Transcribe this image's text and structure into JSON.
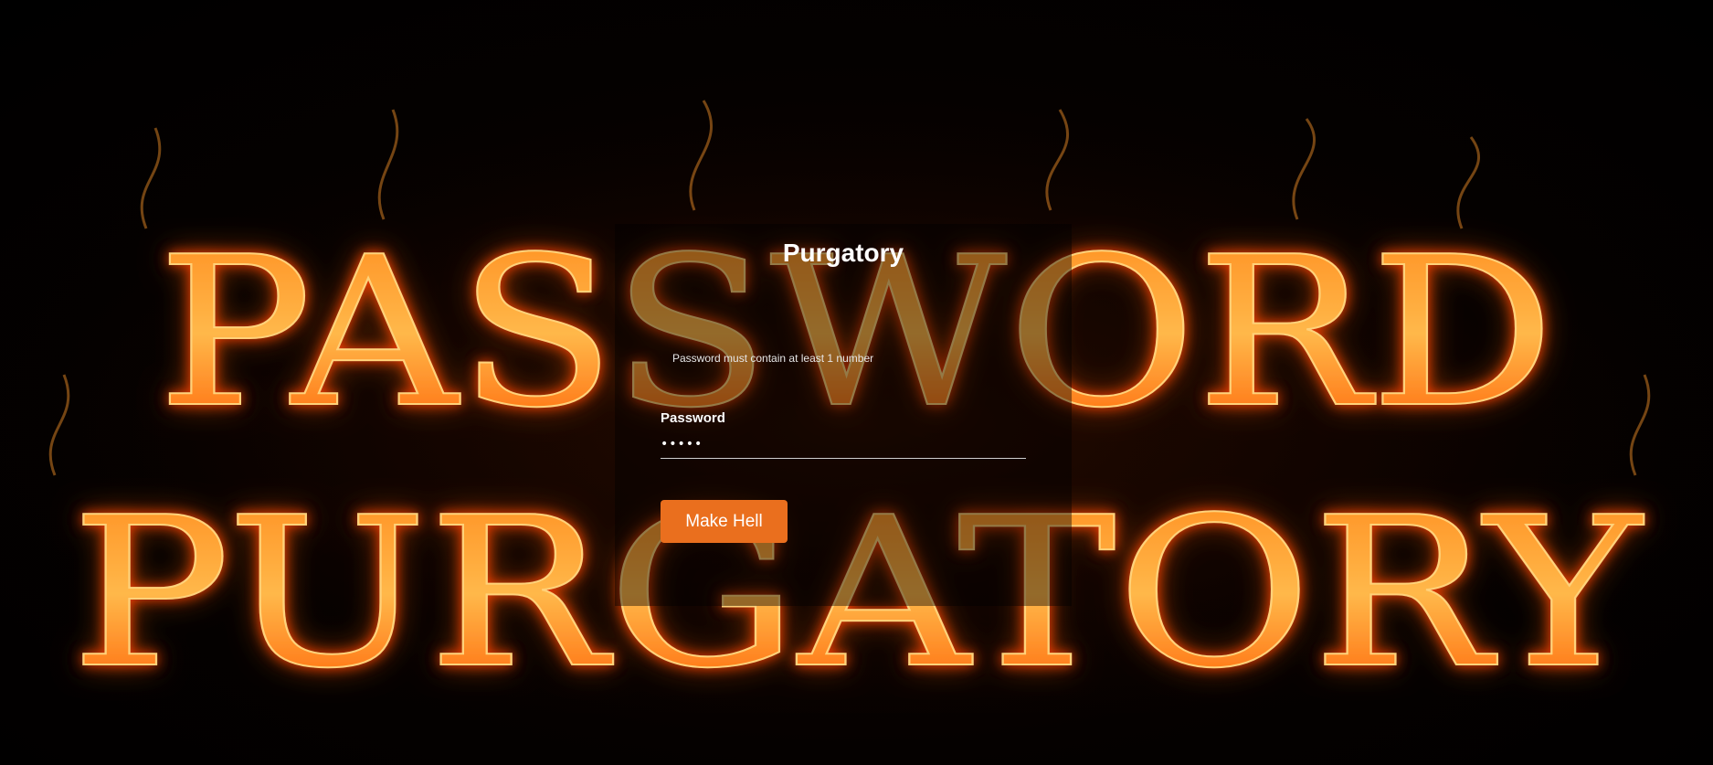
{
  "background": {
    "line1": "PASSWORD",
    "line2": "PURGATORY"
  },
  "form": {
    "title": "Purgatory",
    "rule": "Password must contain at least 1 number",
    "password_label": "Password",
    "password_value": "•••••",
    "submit_label": "Make Hell"
  },
  "colors": {
    "accent": "#ea6f1e",
    "flame_core": "#ffb14a",
    "flame_edge": "#ff3a00",
    "panel": "rgba(0,0,0,0.42)"
  }
}
